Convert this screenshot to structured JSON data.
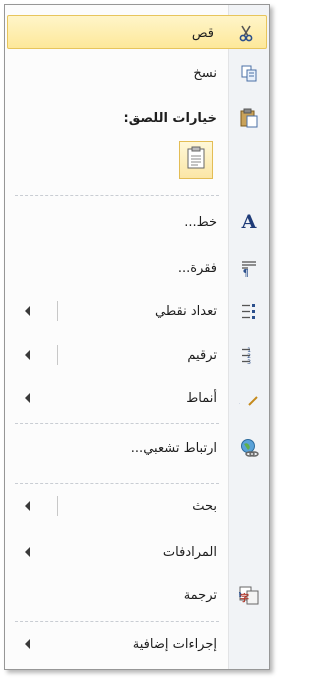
{
  "menu": {
    "cut": "قص",
    "copy": "نسخ",
    "paste_options": "خيارات اللصق:",
    "font": "خط...",
    "paragraph": "فقرة...",
    "bullets": "تعداد نقطي",
    "numbering": "ترقيم",
    "styles": "أنماط",
    "hyperlink": "ارتباط تشعبي...",
    "search": "بحث",
    "synonyms": "المرادفات",
    "translate": "ترجمة",
    "additional_actions": "إجراءات إضافية"
  },
  "colors": {
    "highlight_top": "#fff5c9",
    "highlight_bottom": "#fde89a",
    "gutter": "#f1f3f6"
  }
}
